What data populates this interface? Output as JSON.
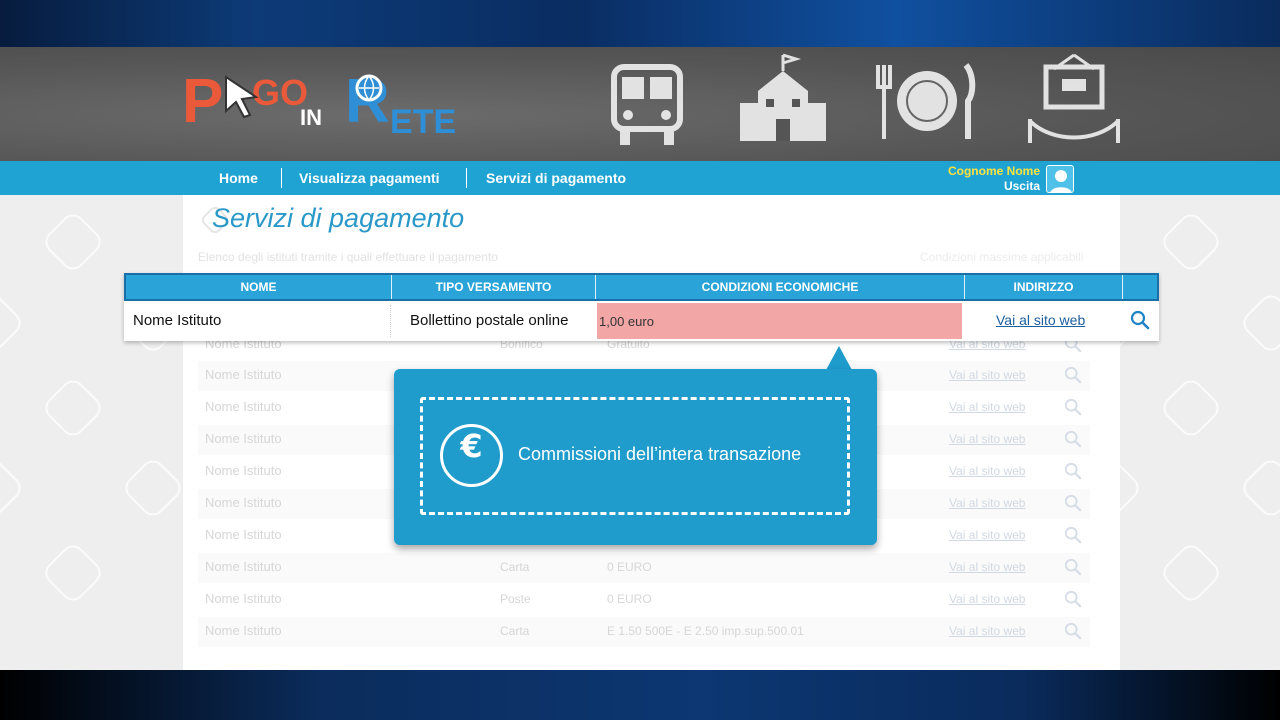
{
  "app": {
    "logo_parts": [
      "P",
      "GO",
      "IN",
      "R",
      "ETE"
    ]
  },
  "nav": {
    "items": [
      "Home",
      "Visualizza pagamenti",
      "Servizi di pagamento"
    ],
    "user_name": "Cognome Nome",
    "logout": "Uscita"
  },
  "page": {
    "title": "Servizi di pagamento",
    "subtitle": "Elenco degli istituti tramite i quali effettuare il pagamento",
    "subtitle_right": "Condizioni massime applicabili"
  },
  "table": {
    "headers": [
      "NOME",
      "TIPO VERSAMENTO",
      "CONDIZIONI ECONOMICHE",
      "INDIRIZZO"
    ],
    "highlighted_row": {
      "name": "Nome Istituto",
      "type": "Bollettino postale online",
      "conditions": "1,00 euro",
      "link": "Vai al sito web"
    },
    "faded_rows": [
      {
        "name": "Nome Istituto",
        "type": "Bonifico",
        "conditions": "Gratuito",
        "link": "Vai al sito web"
      },
      {
        "name": "Nome Istituto",
        "type": "",
        "conditions": "",
        "link": "Vai al sito web"
      },
      {
        "name": "Nome Istituto",
        "type": "",
        "conditions": "",
        "link": "Vai al sito web"
      },
      {
        "name": "Nome Istituto",
        "type": "",
        "conditions": "",
        "link": "Vai al sito web"
      },
      {
        "name": "Nome Istituto",
        "type": "",
        "conditions": "",
        "link": "Vai al sito web"
      },
      {
        "name": "Nome Istituto",
        "type": "",
        "conditions": "",
        "link": "Vai al sito web"
      },
      {
        "name": "Nome Istituto",
        "type": "",
        "conditions": "",
        "link": "Vai al sito web"
      },
      {
        "name": "Nome Istituto",
        "type": "Carta",
        "conditions": "0 EURO",
        "link": "Vai al sito web"
      },
      {
        "name": "Nome Istituto",
        "type": "Poste",
        "conditions": "0 EURO",
        "link": "Vai al sito web"
      },
      {
        "name": "Nome Istituto",
        "type": "Carta",
        "conditions": "E 1.50 500E - E 2.50 imp.sup.500.01",
        "link": "Vai al sito web"
      }
    ]
  },
  "callout": {
    "symbol": "€",
    "text": "Commissioni dell’intera transazione"
  },
  "icons": [
    "cursor-icon",
    "globe-icon",
    "bus-icon",
    "school-icon",
    "cutlery-icon",
    "museum-icon",
    "avatar-icon",
    "search-icon",
    "euro-icon"
  ],
  "colors": {
    "nav": "#1fa3d3",
    "header": "#2aa4d8",
    "highlight": "#f3a6a6",
    "callout": "#1f9ccc",
    "logo_orange": "#ea5a3a",
    "logo_blue": "#2e8fd6",
    "user_yellow": "#ffe33b"
  }
}
